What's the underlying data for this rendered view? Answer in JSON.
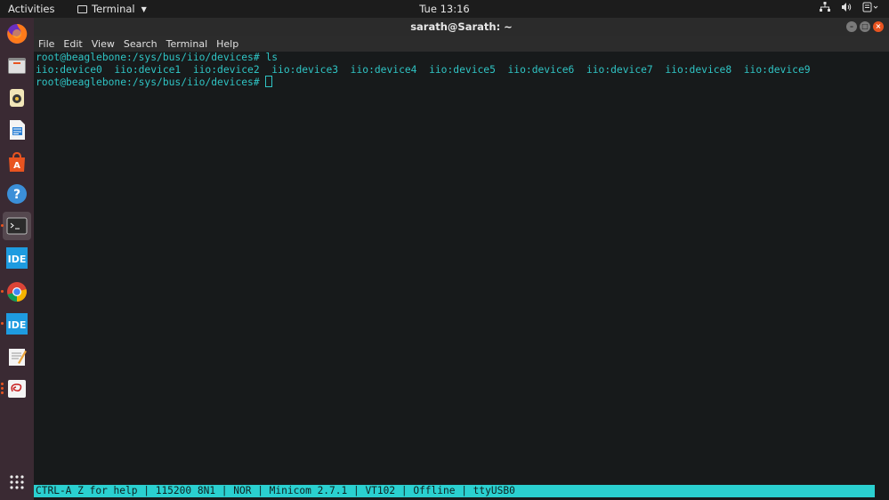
{
  "topbar": {
    "activities": "Activities",
    "app_name": "Terminal",
    "clock": "Tue 13:16",
    "tray_icons": [
      "network-icon",
      "volume-icon",
      "power-icon"
    ]
  },
  "dock": {
    "items": [
      {
        "name": "firefox-icon",
        "color": "#e66000"
      },
      {
        "name": "files-icon",
        "color": "#d9d9d9"
      },
      {
        "name": "rhythmbox-icon",
        "color": "#f0c040"
      },
      {
        "name": "libreoffice-writer-icon",
        "color": "#2a7fd4"
      },
      {
        "name": "software-center-icon",
        "color": "#e95420"
      },
      {
        "name": "help-icon",
        "color": "#3b8fd8"
      },
      {
        "name": "terminal-icon",
        "color": "#2b2b2b"
      },
      {
        "name": "ide-icon",
        "color": "#1e9be0"
      },
      {
        "name": "chrome-icon",
        "color": "#db4437"
      },
      {
        "name": "ide-icon-2",
        "color": "#1e9be0"
      },
      {
        "name": "text-editor-icon",
        "color": "#f4f4f4"
      },
      {
        "name": "pdf-viewer-icon",
        "color": "#f4f4f4"
      }
    ],
    "apps_grid_icon": "apps-grid-icon"
  },
  "window": {
    "title": "sarath@Sarath: ~",
    "menu": [
      "File",
      "Edit",
      "View",
      "Search",
      "Terminal",
      "Help"
    ]
  },
  "terminal": {
    "lines": [
      "root@beaglebone:/sys/bus/iio/devices# ls",
      "iio:device0  iio:device1  iio:device2  iio:device3  iio:device4  iio:device5  iio:device6  iio:device7  iio:device8  iio:device9",
      "root@beaglebone:/sys/bus/iio/devices# "
    ],
    "status_line": "CTRL-A Z for help | 115200 8N1 | NOR | Minicom 2.7.1 | VT102 | Offline | ttyUSB0"
  },
  "colors": {
    "terminal_text": "#2fc4c4",
    "status_bg": "#2ad0d0",
    "dock_bg": "#3a2a33",
    "accent": "#e95420"
  }
}
